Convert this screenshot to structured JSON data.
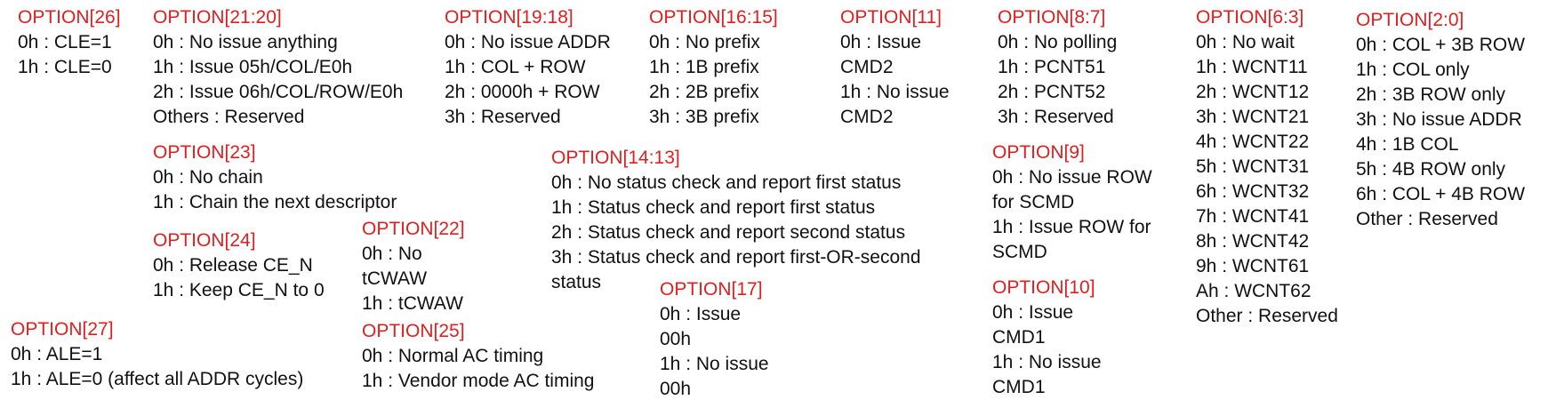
{
  "accent_color": "#e02020",
  "text_color": "#111111",
  "option_26": {
    "title": "OPTION[26]",
    "lines": [
      "0h : CLE=1",
      "1h : CLE=0"
    ]
  },
  "option_27": {
    "title": "OPTION[27]",
    "lines": [
      "0h : ALE=1",
      "1h : ALE=0  (affect all ADDR cycles)"
    ]
  },
  "option_21_20": {
    "title": "OPTION[21:20]",
    "lines": [
      "0h : No issue anything",
      "1h : Issue 05h/COL/E0h",
      "2h : Issue 06h/COL/ROW/E0h",
      "Others : Reserved"
    ]
  },
  "option_23": {
    "title": "OPTION[23]",
    "lines": [
      "0h : No chain",
      "1h : Chain the next descriptor"
    ]
  },
  "option_24": {
    "title": "OPTION[24]",
    "lines": [
      "0h : Release CE_N",
      "1h : Keep CE_N to 0"
    ]
  },
  "option_22": {
    "title": "OPTION[22]",
    "lines": [
      "0h : No",
      "tCWAW",
      "1h : tCWAW"
    ]
  },
  "option_25": {
    "title": "OPTION[25]",
    "lines": [
      "0h : Normal AC timing",
      "1h : Vendor mode AC timing"
    ]
  },
  "option_19_18": {
    "title": "OPTION[19:18]",
    "lines": [
      "0h : No issue ADDR",
      "1h : COL + ROW",
      "2h : 0000h + ROW",
      "3h : Reserved"
    ]
  },
  "option_16_15": {
    "title": "OPTION[16:15]",
    "lines": [
      "0h : No prefix",
      "1h : 1B prefix",
      "2h : 2B prefix",
      "3h : 3B prefix"
    ]
  },
  "option_14_13": {
    "title": "OPTION[14:13]",
    "lines": [
      "0h : No status check and report first status",
      "1h : Status check and report first status",
      "2h : Status check and report second status",
      "3h : Status check and report first-OR-second",
      "status"
    ]
  },
  "option_17": {
    "title": "OPTION[17]",
    "lines": [
      "0h : Issue",
      "00h",
      "1h : No issue",
      "00h"
    ]
  },
  "option_11": {
    "title": "OPTION[11]",
    "lines": [
      "0h : Issue",
      "CMD2",
      "1h : No issue",
      "CMD2"
    ]
  },
  "option_8_7": {
    "title": "OPTION[8:7]",
    "lines": [
      "0h : No polling",
      "1h : PCNT51",
      "2h : PCNT52",
      "3h : Reserved"
    ]
  },
  "option_9": {
    "title": "OPTION[9]",
    "lines": [
      "0h : No issue ROW",
      "for SCMD",
      "1h : Issue ROW for",
      "SCMD"
    ]
  },
  "option_10": {
    "title": "OPTION[10]",
    "lines": [
      "0h : Issue",
      "CMD1",
      "1h : No issue",
      "CMD1"
    ]
  },
  "option_6_3": {
    "title": "OPTION[6:3]",
    "lines": [
      "0h : No wait",
      "1h : WCNT11",
      "2h : WCNT12",
      "3h : WCNT21",
      "4h : WCNT22",
      "5h : WCNT31",
      "6h : WCNT32",
      "7h : WCNT41",
      "8h : WCNT42",
      "9h : WCNT61",
      "Ah : WCNT62",
      "Other : Reserved"
    ]
  },
  "option_2_0": {
    "title": "OPTION[2:0]",
    "lines": [
      "0h : COL + 3B ROW",
      "1h : COL only",
      "2h : 3B ROW only",
      "3h : No issue ADDR",
      "4h : 1B COL",
      "5h : 4B ROW only",
      "6h : COL + 4B ROW",
      "Other : Reserved"
    ]
  }
}
